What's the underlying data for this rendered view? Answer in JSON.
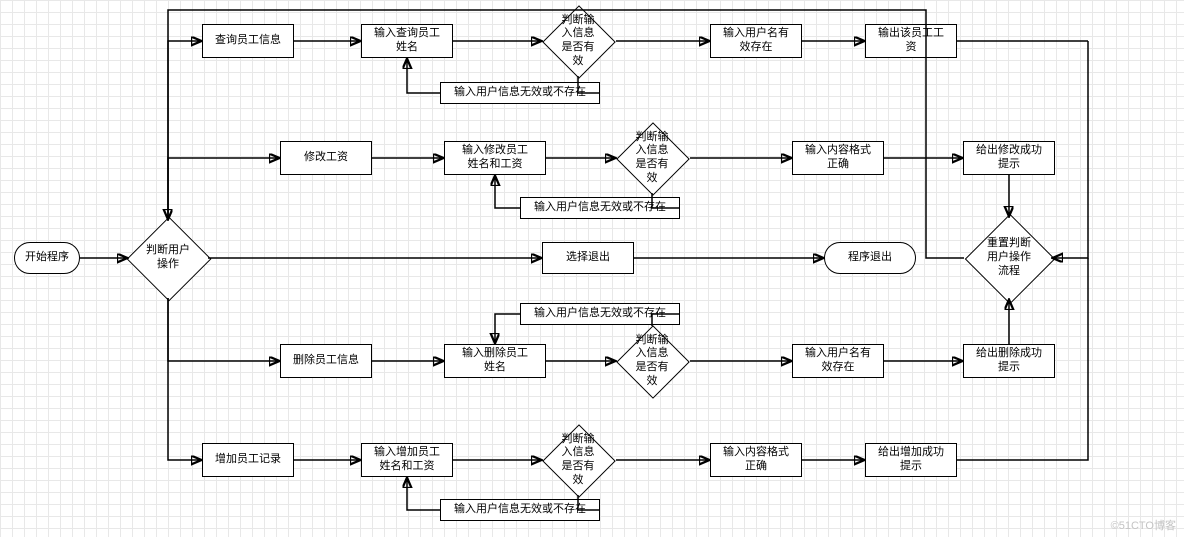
{
  "nodes": {
    "start": "开始程序",
    "judge": "判断用户操作",
    "query_info": "查询员工信息",
    "query_name": "输入查询员工\n姓名",
    "query_valid": "判断输入信息是否有效",
    "query_exist": "输入用户名有\n效存在",
    "query_out": "输出该员工工\n资",
    "invalid1": "输入用户信息无效或不存在",
    "modify": "修改工资",
    "modify_in": "输入修改员工\n姓名和工资",
    "modify_valid": "判断输入信息是否有效",
    "modify_fmt": "输入内容格式\n正确",
    "modify_ok": "给出修改成功\n提示",
    "invalid2": "输入用户信息无效或不存在",
    "select_exit": "选择退出",
    "prog_exit": "程序退出",
    "reset": "重置判断用户操作流程",
    "delete": "删除员工信息",
    "delete_in": "输入删除员工\n姓名",
    "delete_valid": "判断输入信息是否有效",
    "delete_exist": "输入用户名有\n效存在",
    "delete_ok": "给出删除成功\n提示",
    "invalid3": "输入用户信息无效或不存在",
    "add": "增加员工记录",
    "add_in": "输入增加员工\n姓名和工资",
    "add_valid": "判断输入信息是否有效",
    "add_fmt": "输入内容格式\n正确",
    "add_ok": "给出增加成功\n提示",
    "invalid4": "输入用户信息无效或不存在"
  },
  "watermark": "©51CTO博客"
}
